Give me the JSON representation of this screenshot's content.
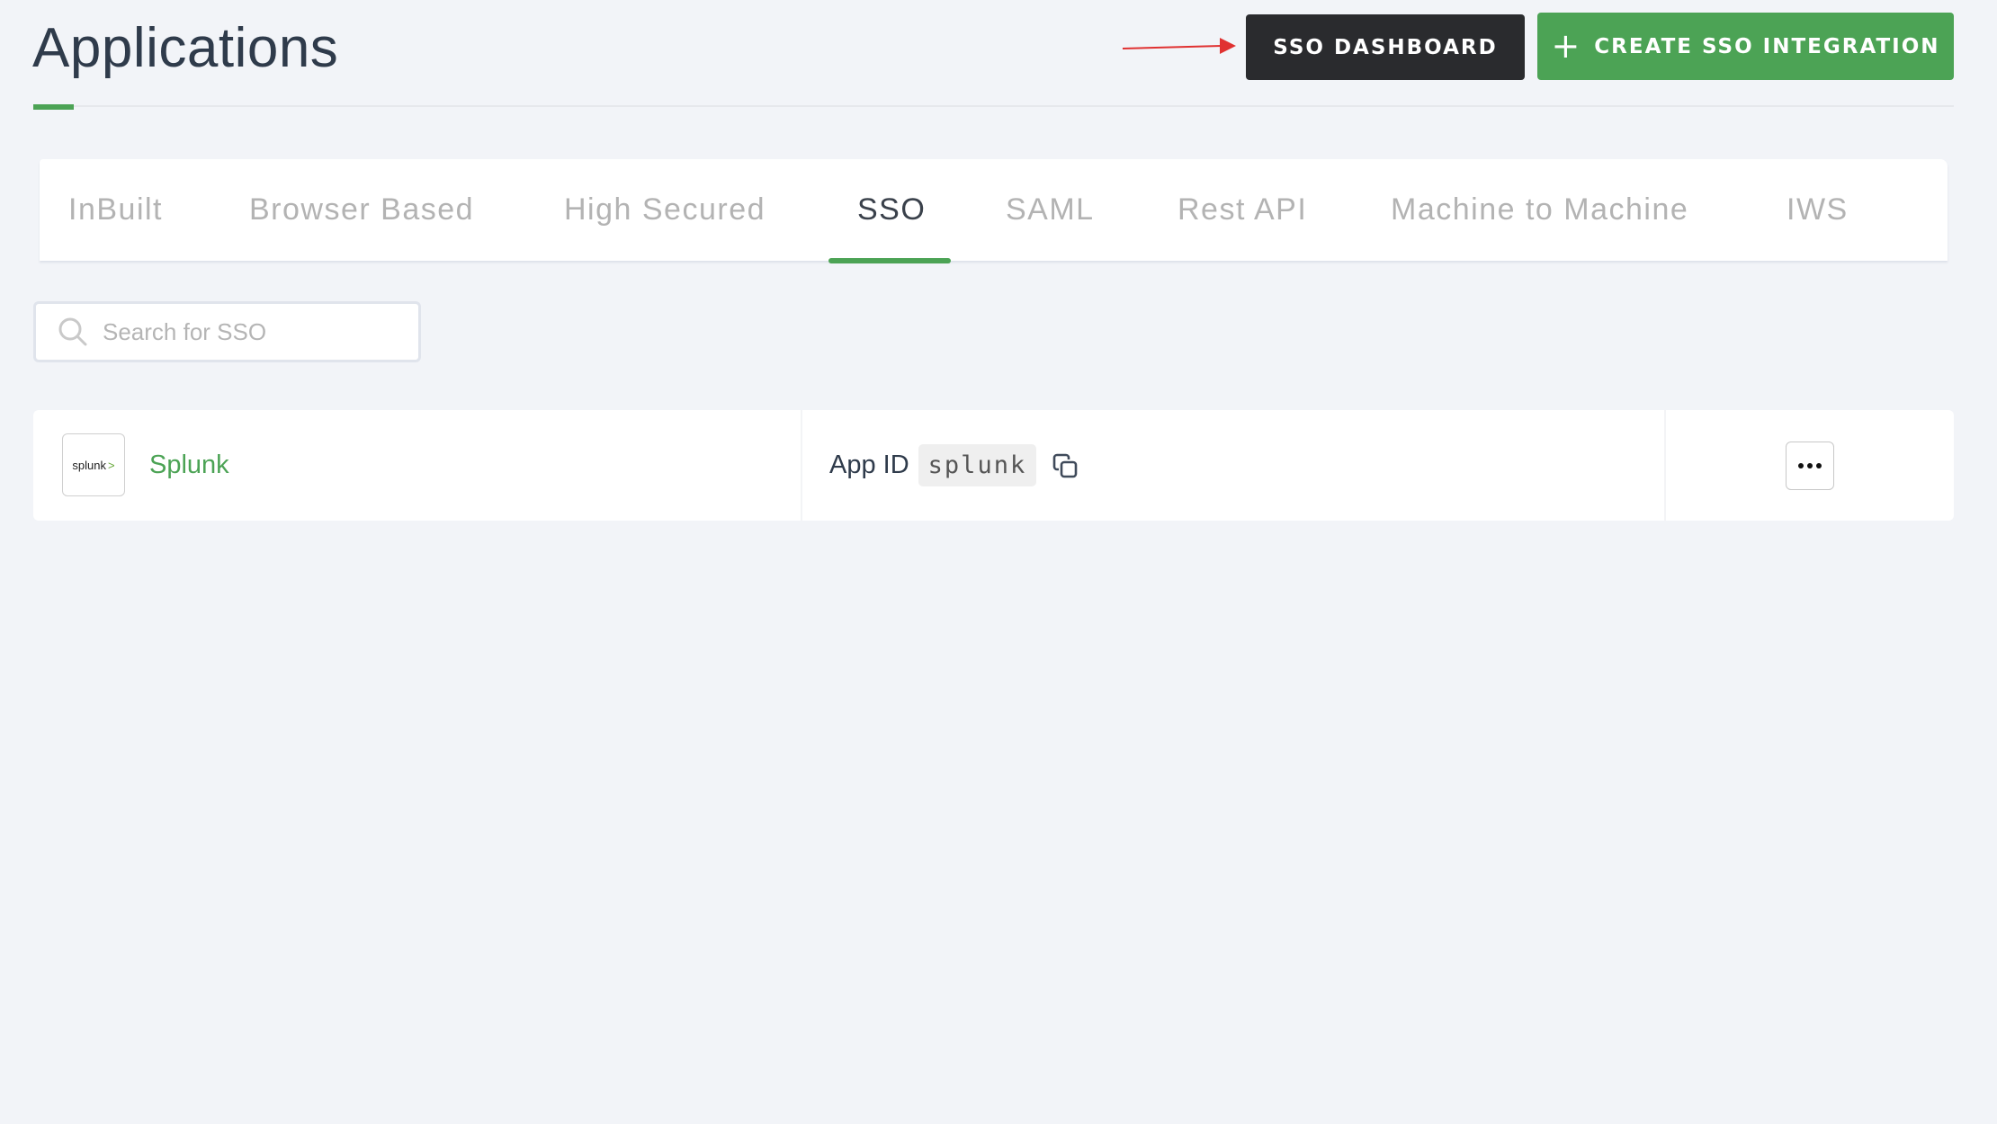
{
  "header": {
    "title": "Applications",
    "sso_dashboard_label": "SSO DASHBOARD",
    "create_sso_label": "CREATE SSO INTEGRATION",
    "create_icon": "plus-icon",
    "annotation_arrow_color": "#e03131"
  },
  "tabs": [
    {
      "label": "InBuilt",
      "active": false
    },
    {
      "label": "Browser Based",
      "active": false
    },
    {
      "label": "High Secured",
      "active": false
    },
    {
      "label": "SSO",
      "active": true
    },
    {
      "label": "SAML",
      "active": false
    },
    {
      "label": "Rest API",
      "active": false
    },
    {
      "label": "Machine to Machine",
      "active": false
    },
    {
      "label": "IWS",
      "active": false
    }
  ],
  "search": {
    "placeholder": "Search for SSO",
    "value": "",
    "icon": "search-icon"
  },
  "applications": [
    {
      "logo_text": "splunk",
      "logo_chevron": ">",
      "name": "Splunk",
      "app_id_label": "App ID",
      "app_id": "splunk",
      "copy_icon": "copy-icon",
      "more_icon": "more-horizontal-icon"
    }
  ],
  "colors": {
    "accent": "#4ca355",
    "dark_button": "#2a2b2e",
    "title_text": "#2f3b4b",
    "inactive_tab": "#b3b3b3",
    "background": "#f2f4f8"
  }
}
